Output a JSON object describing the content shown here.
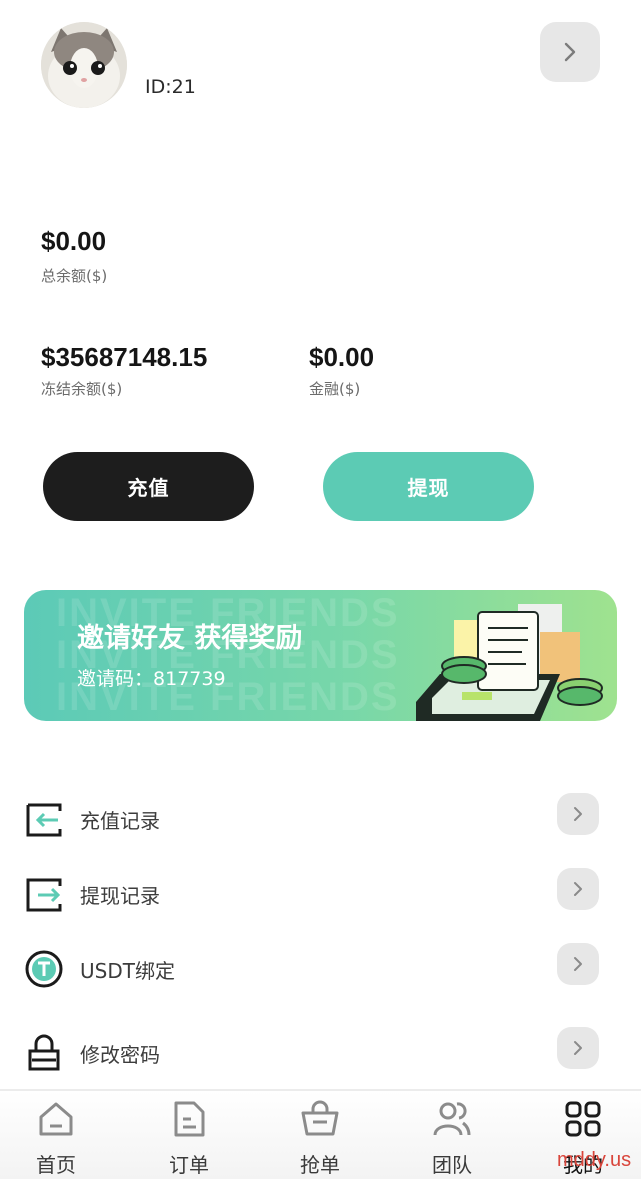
{
  "profile": {
    "user_id": "ID:21"
  },
  "balances": {
    "total_amount": "$0.00",
    "total_label": "总余额($)",
    "frozen_amount": "$35687148.15",
    "frozen_label": "冻结余额($)",
    "finance_amount": "$0.00",
    "finance_label": "金融($)"
  },
  "actions": {
    "recharge_label": "充值",
    "withdraw_label": "提现"
  },
  "invite_banner": {
    "watermark": "INVITE FRIENDS",
    "title": "邀请好友 获得奖励",
    "code_label": "邀请码：",
    "code_value": "817739"
  },
  "menu": {
    "items": [
      {
        "label": "充值记录",
        "icon": "recharge-record-icon"
      },
      {
        "label": "提现记录",
        "icon": "withdraw-record-icon"
      },
      {
        "label": "USDT绑定",
        "icon": "usdt-icon"
      },
      {
        "label": "修改密码",
        "icon": "lock-icon"
      }
    ]
  },
  "tabbar": {
    "items": [
      {
        "label": "首页",
        "icon": "home-icon"
      },
      {
        "label": "订单",
        "icon": "order-icon"
      },
      {
        "label": "抢单",
        "icon": "bag-icon"
      },
      {
        "label": "团队",
        "icon": "team-icon"
      },
      {
        "label": "我的",
        "icon": "grid-icon",
        "active": true
      }
    ]
  },
  "watermark_text": "mddy.us",
  "colors": {
    "accent": "#5ccbb4",
    "dark_button": "#1d1d1d",
    "chevron_bg": "#e7e7e7"
  }
}
